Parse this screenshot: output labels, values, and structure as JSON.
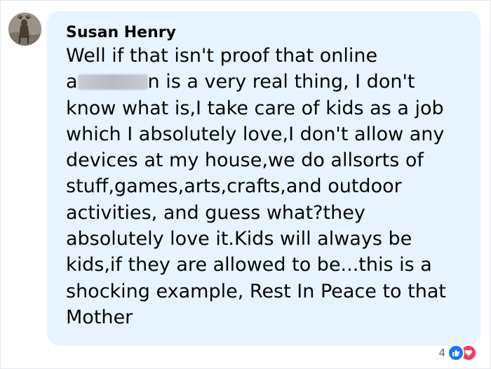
{
  "comment": {
    "author": "Susan Henry",
    "lines": [
      "Well if that isn't proof that online",
      {
        "prefix": "a",
        "suffix": "n is a very real thing, I don't"
      },
      "know what is,I take care of kids as a job",
      "which I absolutely love,I don't allow any",
      "devices at my house,we do allsorts of",
      "stuff,games,arts,crafts,and outdoor",
      "activities, and guess what?they",
      "absolutely love it.Kids will always be",
      "kids,if they are allowed to be...this is a",
      "shocking example, Rest In Peace to that",
      "Mother"
    ],
    "reactions": {
      "count": "4",
      "icons": [
        "like-icon",
        "love-icon"
      ]
    }
  },
  "colors": {
    "bubble": "#e7f3ff",
    "like": "#1877f2",
    "love": "#f33e58"
  }
}
